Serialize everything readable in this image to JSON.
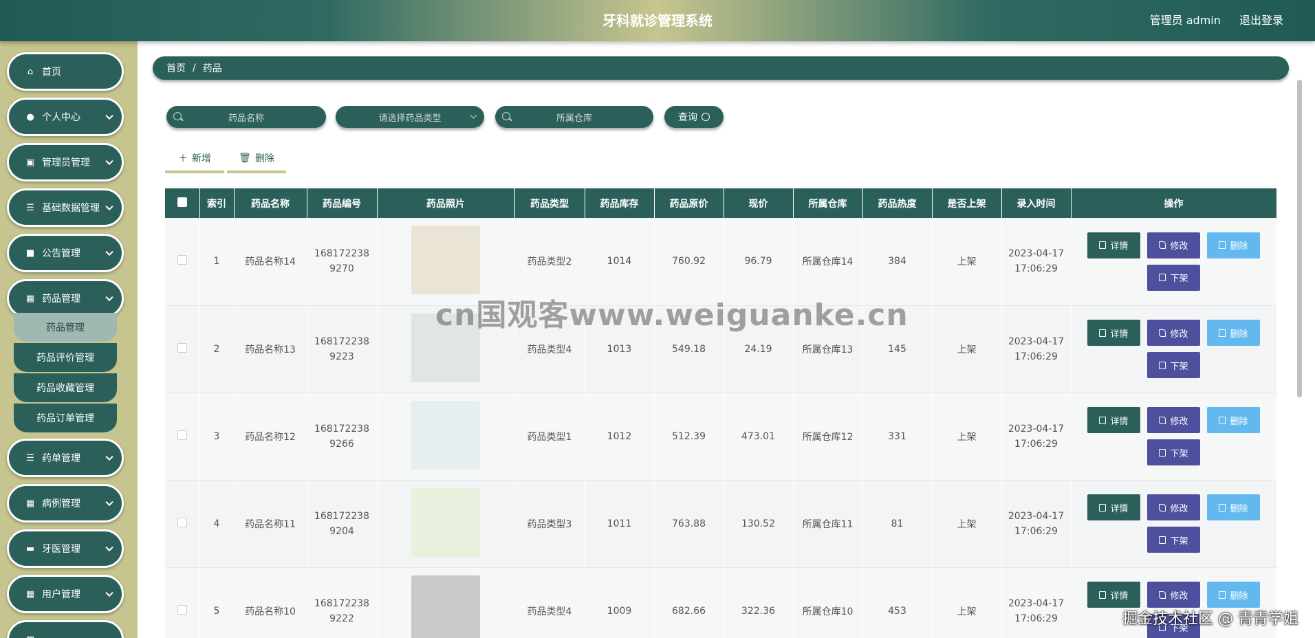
{
  "header": {
    "title": "牙科就诊管理系统",
    "user": "管理员 admin",
    "logout": "退出登录"
  },
  "sidebar": {
    "items": [
      {
        "label": "首页",
        "icon": "home-icon"
      },
      {
        "label": "个人中心",
        "icon": "user-icon"
      },
      {
        "label": "管理员管理",
        "icon": "clipboard-icon"
      },
      {
        "label": "基础数据管理",
        "icon": "list-icon"
      },
      {
        "label": "公告管理",
        "icon": "thumb-icon"
      },
      {
        "label": "药品管理",
        "icon": "grid-icon"
      },
      {
        "label": "药单管理",
        "icon": "list-icon"
      },
      {
        "label": "病例管理",
        "icon": "grid-icon"
      },
      {
        "label": "牙医管理",
        "icon": "card-icon"
      },
      {
        "label": "用户管理",
        "icon": "grid-icon"
      },
      {
        "label": "",
        "icon": "grid-icon"
      }
    ],
    "submenu": [
      "药品管理",
      "药品评价管理",
      "药品收藏管理",
      "药品订单管理"
    ]
  },
  "breadcrumb": {
    "home": "首页",
    "sep": "/",
    "current": "药品"
  },
  "search": {
    "name_placeholder": "药品名称",
    "type_placeholder": "请选择药品类型",
    "warehouse_placeholder": "所属仓库",
    "query_label": "查询"
  },
  "actions": {
    "add": "新增",
    "delete": "删除"
  },
  "table": {
    "columns": [
      "",
      "索引",
      "药品名称",
      "药品编号",
      "药品照片",
      "药品类型",
      "药品库存",
      "药品原价",
      "现价",
      "所属仓库",
      "药品热度",
      "是否上架",
      "录入时间",
      "操作"
    ],
    "rows": [
      {
        "idx": "1",
        "name": "药品名称14",
        "code1": "168172238",
        "code2": "9270",
        "type": "药品类型2",
        "stock": "1014",
        "orig": "760.92",
        "price": "96.79",
        "wh": "所属仓库14",
        "heat": "384",
        "status": "上架",
        "date": "2023-04-17",
        "time": "17:06:29",
        "thumb": "#e9e4d4"
      },
      {
        "idx": "2",
        "name": "药品名称13",
        "code1": "168172238",
        "code2": "9223",
        "type": "药品类型4",
        "stock": "1013",
        "orig": "549.18",
        "price": "24.19",
        "wh": "所属仓库13",
        "heat": "145",
        "status": "上架",
        "date": "2023-04-17",
        "time": "17:06:29",
        "thumb": "#dfe6e4"
      },
      {
        "idx": "3",
        "name": "药品名称12",
        "code1": "168172238",
        "code2": "9266",
        "type": "药品类型1",
        "stock": "1012",
        "orig": "512.39",
        "price": "473.01",
        "wh": "所属仓库12",
        "heat": "331",
        "status": "上架",
        "date": "2023-04-17",
        "time": "17:06:29",
        "thumb": "#e7eef0"
      },
      {
        "idx": "4",
        "name": "药品名称11",
        "code1": "168172238",
        "code2": "9204",
        "type": "药品类型3",
        "stock": "1011",
        "orig": "763.88",
        "price": "130.52",
        "wh": "所属仓库11",
        "heat": "81",
        "status": "上架",
        "date": "2023-04-17",
        "time": "17:06:29",
        "thumb": "#e8f1de"
      },
      {
        "idx": "5",
        "name": "药品名称10",
        "code1": "168172238",
        "code2": "9222",
        "type": "药品类型4",
        "stock": "1009",
        "orig": "682.66",
        "price": "322.36",
        "wh": "所属仓库10",
        "heat": "453",
        "status": "上架",
        "date": "2023-04-17",
        "time": "17:06:29",
        "thumb": "#c9c9c9"
      }
    ],
    "ops": {
      "detail": "详情",
      "edit": "修改",
      "delete": "删除",
      "off": "下架"
    }
  },
  "watermark": "cn国观客www.weiguanke.cn",
  "footer_mark": "掘金技术社区 @ 青青学姐"
}
